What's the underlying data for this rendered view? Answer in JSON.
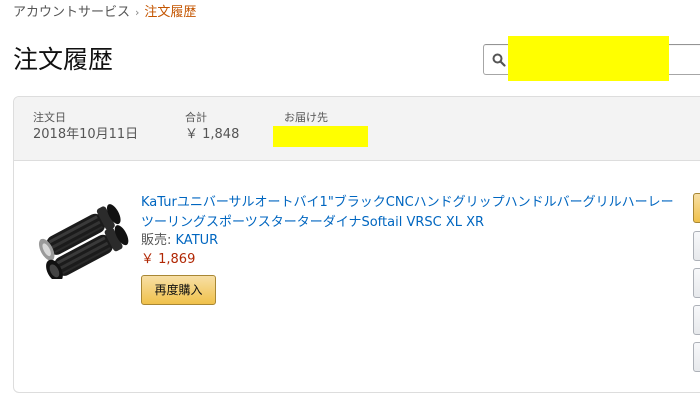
{
  "breadcrumb": {
    "parent": "アカウントサービス",
    "separator": "›",
    "current": "注文履歴"
  },
  "page": {
    "title": "注文履歴"
  },
  "search": {
    "value": "",
    "placeholder": ""
  },
  "order": {
    "date_label": "注文日",
    "date_value": "2018年10月11日",
    "total_label": "合計",
    "total_value": "￥ 1,848",
    "ship_to_label": "お届け先",
    "item": {
      "title": "KaTurユニバーサルオートバイ1\"ブラックCNCハンドグリップハンドルバーグリルハーレーツーリングスポーツスターターダイナSoftail VRSC XL XR",
      "seller_label": "販売: ",
      "seller_name": "KATUR",
      "price": "￥ 1,869",
      "buy_again_label": "再度購入"
    }
  },
  "colors": {
    "link": "#0066c0",
    "price": "#b12704",
    "breadcrumb_current": "#c45500",
    "redaction": "#ffff00"
  }
}
